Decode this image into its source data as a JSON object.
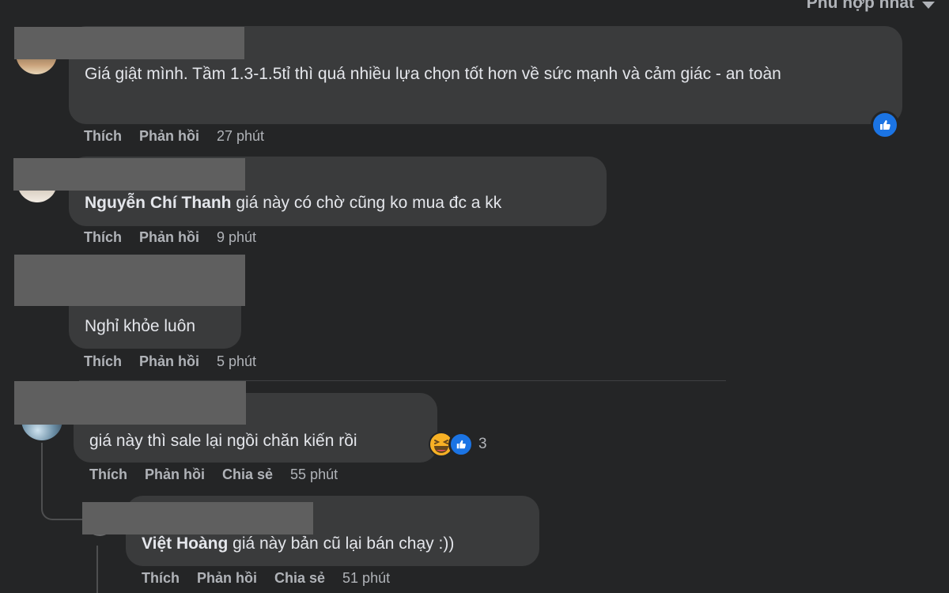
{
  "sort": {
    "label": "Phù hợp nhất"
  },
  "comments": [
    {
      "text": "Giá giật mình. Tầm 1.3-1.5tỉ thì quá nhiều lựa chọn tốt hơn về sức mạnh và cảm giác - an toàn",
      "actions": {
        "like": "Thích",
        "reply": "Phản hồi"
      },
      "time": "27 phút"
    },
    {
      "author": "Nguyễn Chí Thanh",
      "text": "giá này có chờ cũng ko mua đc a kk",
      "actions": {
        "like": "Thích",
        "reply": "Phản hồi"
      },
      "time": "9 phút"
    },
    {
      "text": "Nghỉ khỏe luôn",
      "actions": {
        "like": "Thích",
        "reply": "Phản hồi"
      },
      "time": "5 phút"
    },
    {
      "text": "giá này thì sale lại ngồi chăn kiến rồi",
      "reaction_count": "3",
      "actions": {
        "like": "Thích",
        "reply": "Phản hồi",
        "share": "Chia sẻ"
      },
      "time": "55 phút"
    },
    {
      "author": "Việt Hoàng",
      "text": "giá này bản cũ lại bán chạy :))",
      "actions": {
        "like": "Thích",
        "reply": "Phản hồi",
        "share": "Chia sẻ"
      },
      "time": "51 phút"
    }
  ],
  "colors": {
    "background": "#242526",
    "bubble": "#3a3b3c",
    "text": "#e4e6eb",
    "muted": "#b0b3b8",
    "like_blue": "#1b74e4",
    "redaction": "#5f5f5f"
  }
}
